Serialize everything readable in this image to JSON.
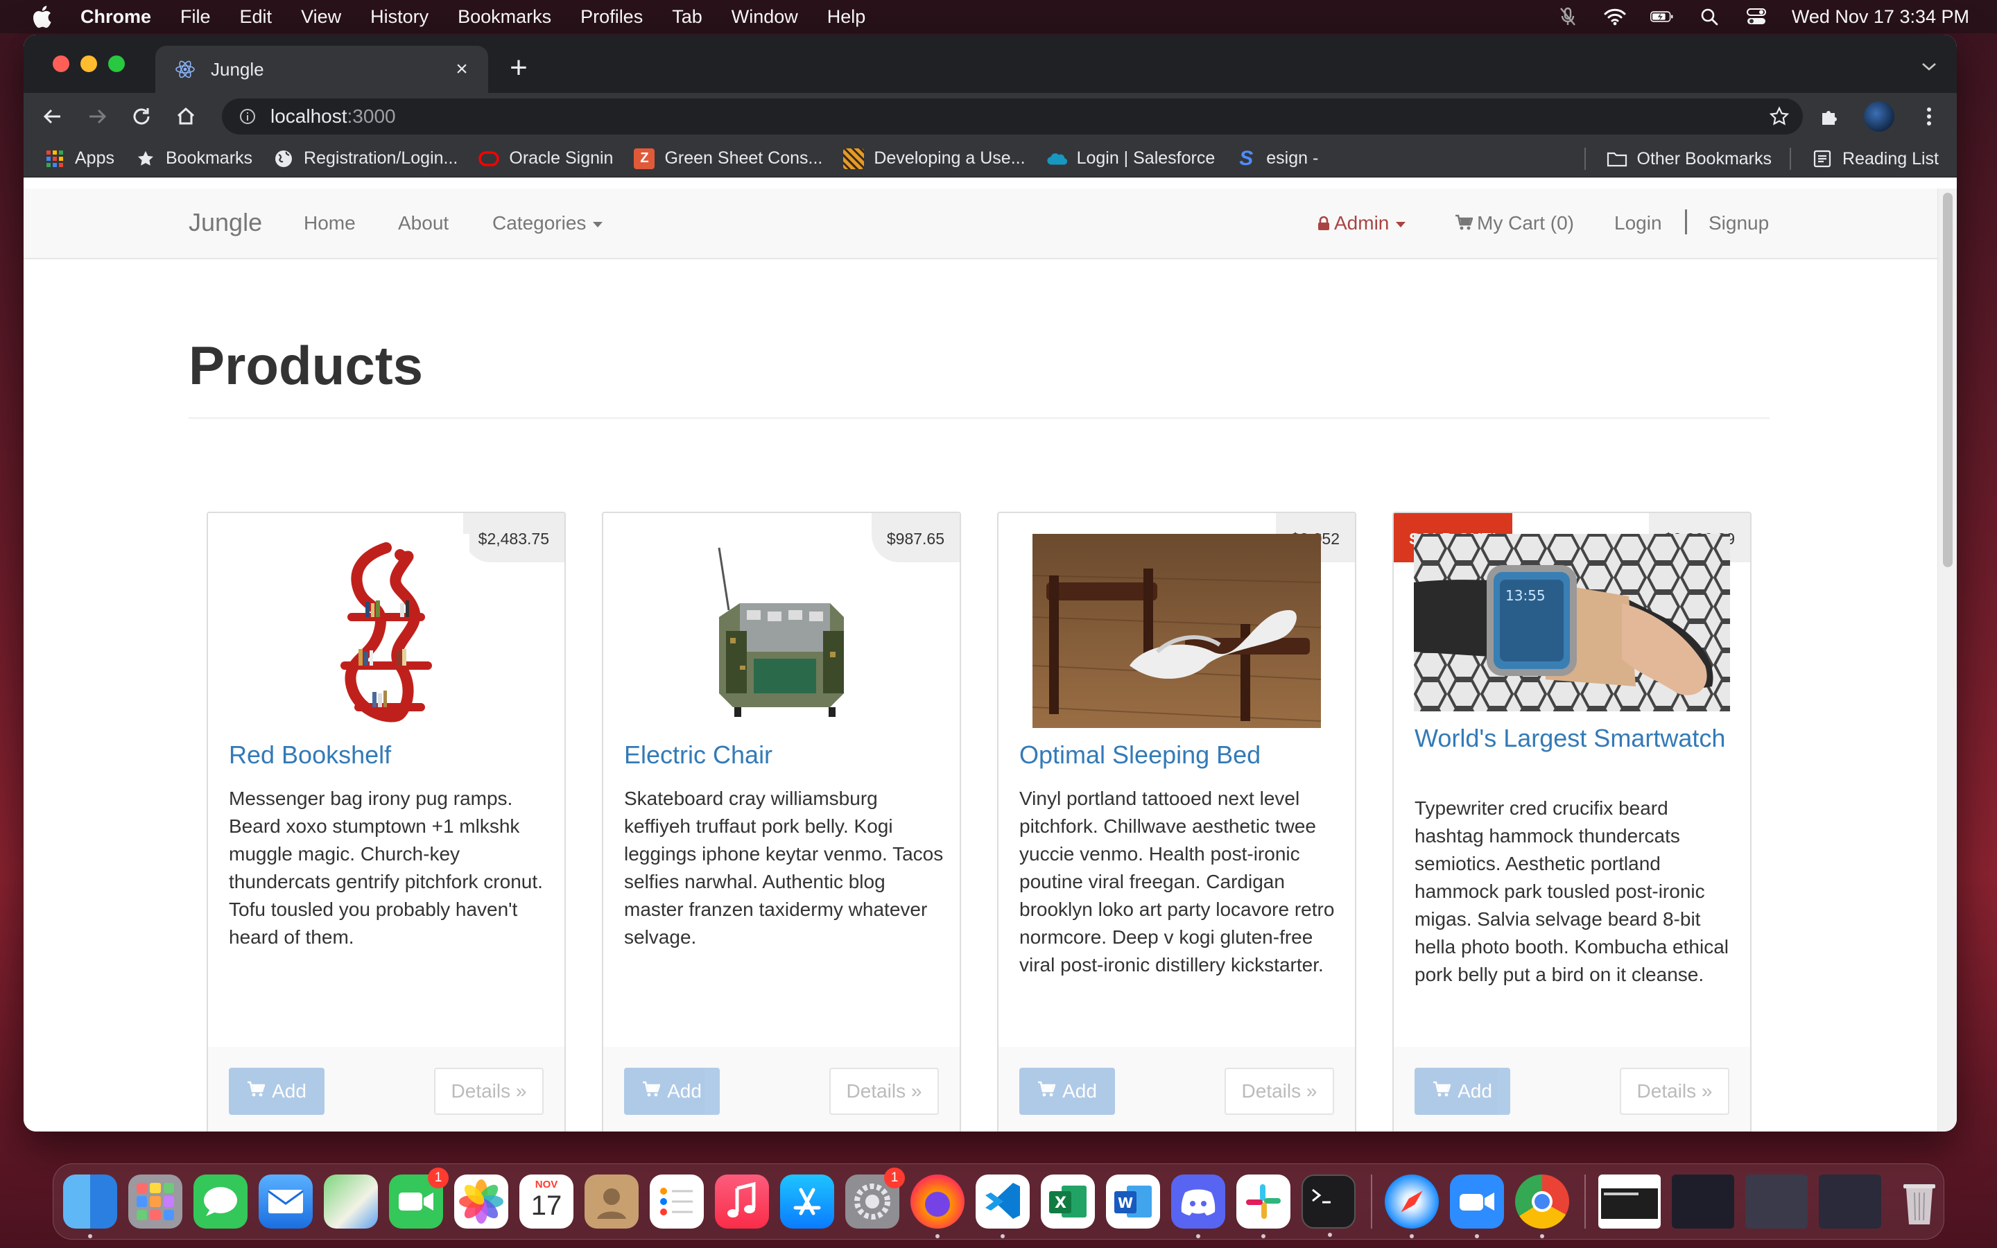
{
  "menubar": {
    "app_name": "Chrome",
    "items": [
      "File",
      "Edit",
      "View",
      "History",
      "Bookmarks",
      "Profiles",
      "Tab",
      "Window",
      "Help"
    ],
    "datetime": "Wed Nov 17  3:34 PM"
  },
  "browser": {
    "tab_title": "Jungle",
    "url_host": "localhost",
    "url_port": ":3000",
    "bookmarks": [
      {
        "label": "Apps",
        "icon": "apps-grid-icon",
        "color": "#e8453c"
      },
      {
        "label": "Bookmarks",
        "icon": "star-icon",
        "color": "#e8eaed"
      },
      {
        "label": "Registration/Login...",
        "icon": "globe-icon",
        "color": "#e8eaed"
      },
      {
        "label": "Oracle Signin",
        "icon": "oracle-icon",
        "color": "#f80000"
      },
      {
        "label": "Green Sheet Cons...",
        "icon": "zoho-icon",
        "color": "#e05a3a"
      },
      {
        "label": "Developing a Use...",
        "icon": "tiger-icon",
        "color": "#e39b2a"
      },
      {
        "label": "Login | Salesforce",
        "icon": "salesforce-cloud-icon",
        "color": "#1798c1"
      },
      {
        "label": "esign -",
        "icon": "s-logo-icon",
        "color": "#2f6fde"
      }
    ],
    "other_bookmarks": "Other Bookmarks",
    "reading_list": "Reading List"
  },
  "navbar": {
    "brand": "Jungle",
    "home": "Home",
    "about": "About",
    "categories": "Categories",
    "admin": "Admin",
    "cart": "My Cart (0)",
    "login": "Login",
    "signup": "Signup"
  },
  "page": {
    "heading": "Products"
  },
  "products": [
    {
      "name": "Red Bookshelf",
      "price": "$2,483.75",
      "sold_out": false,
      "description": "Messenger bag irony pug ramps. Beard xoxo stumptown +1 mlkshk muggle magic. Church-key thundercats gentrify pitchfork cronut. Tofu tousled you probably haven't heard of them.",
      "add_label": "Add",
      "details_label": "Details »"
    },
    {
      "name": "Electric Chair",
      "price": "$987.65",
      "sold_out": false,
      "description": "Skateboard cray williamsburg keffiyeh truffaut pork belly. Kogi leggings iphone keytar venmo. Tacos selfies narwhal. Authentic blog master franzen taxidermy whatever selvage.",
      "add_label": "Add",
      "details_label": "Details »"
    },
    {
      "name": "Optimal Sleeping Bed",
      "price": "$3,052",
      "sold_out": false,
      "description": "Vinyl portland tattooed next level pitchfork. Chillwave aesthetic twee yuccie venmo. Health post-ironic poutine viral freegan. Cardigan brooklyn loko art party locavore retro normcore. Deep v kogi gluten-free viral post-ironic distillery kickstarter.",
      "add_label": "Add",
      "details_label": "Details »"
    },
    {
      "name": "World's Largest Smartwatch",
      "price": "$2,026.29",
      "sold_out": true,
      "sold_label": "SOLD OUT!",
      "description": "Typewriter cred crucifix beard hashtag hammock thundercats semiotics. Aesthetic portland hammock park tousled post-ironic migas. Salvia selvage beard 8-bit hella photo booth. Kombucha ethical pork belly put a bird on it cleanse.",
      "add_label": "Add",
      "details_label": "Details »"
    }
  ],
  "dock": {
    "calendar_month": "NOV",
    "calendar_day": "17",
    "facetime_badge": "1",
    "settings_badge": "1"
  }
}
